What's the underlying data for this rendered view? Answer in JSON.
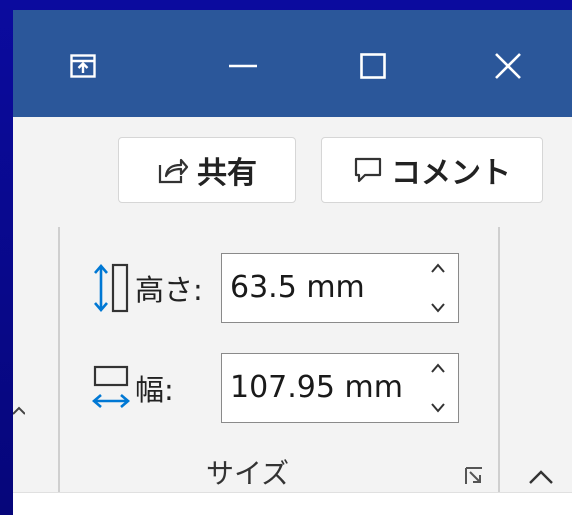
{
  "titlebar": {
    "background": "#2b579a",
    "buttons": [
      {
        "name": "ribbon-display-options",
        "icon": "ribbon-display-icon"
      },
      {
        "name": "minimize",
        "icon": "minimize-icon"
      },
      {
        "name": "maximize",
        "icon": "maximize-icon"
      },
      {
        "name": "close",
        "icon": "close-icon"
      }
    ]
  },
  "actions": {
    "share_label": "共有",
    "share_icon": "share-icon",
    "comment_label": "コメント",
    "comment_icon": "comment-icon"
  },
  "size_group": {
    "label": "サイズ",
    "height": {
      "label": "高さ:",
      "value": "63.5 mm",
      "icon": "shape-height-icon"
    },
    "width": {
      "label": "幅:",
      "value": "107.95 mm",
      "icon": "shape-width-icon"
    },
    "launcher_icon": "dialog-launcher-icon"
  },
  "ribbon": {
    "collapse_icon": "collapse-ribbon-icon",
    "accent": "#0078d4"
  }
}
